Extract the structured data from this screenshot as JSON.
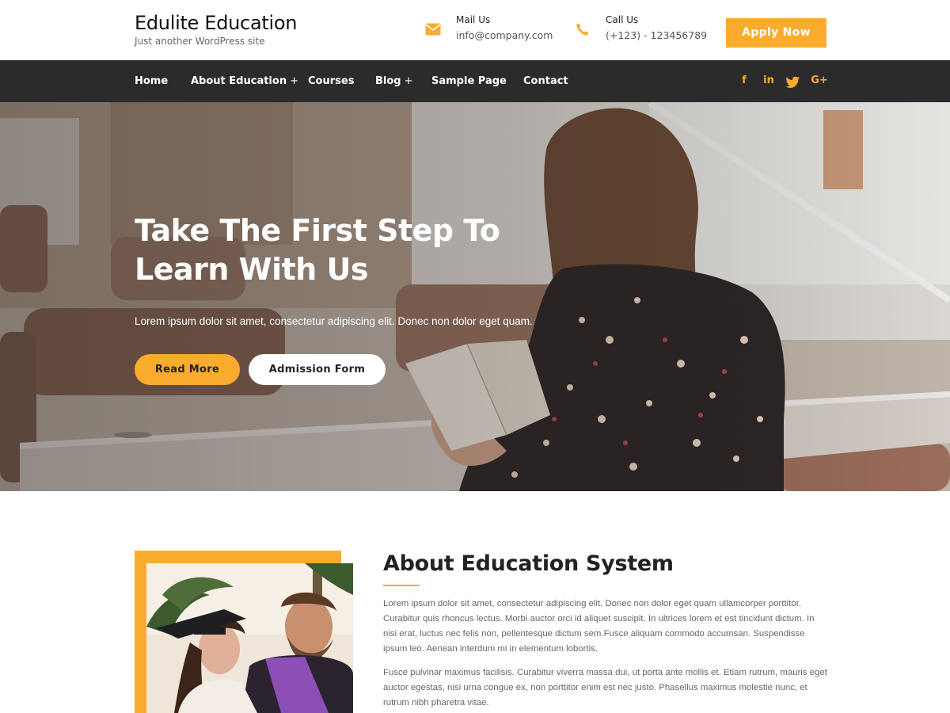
{
  "header": {
    "site_title": "Edulite Education",
    "tagline": "Just another WordPress site",
    "mail": {
      "label": "Mail Us",
      "value": "info@company.com",
      "icon": "envelope-icon"
    },
    "call": {
      "label": "Call Us",
      "value": "(+123) - 123456789",
      "icon": "phone-icon"
    },
    "apply_label": "Apply Now"
  },
  "nav": {
    "items": [
      {
        "label": "Home",
        "has_submenu": false
      },
      {
        "label": "About Education",
        "has_submenu": true
      },
      {
        "label": "Courses",
        "has_submenu": false
      },
      {
        "label": "Blog",
        "has_submenu": true
      },
      {
        "label": "Sample Page",
        "has_submenu": false
      },
      {
        "label": "Contact",
        "has_submenu": false
      }
    ],
    "submenu_indicator": "+",
    "social": [
      {
        "name": "facebook-icon",
        "glyph": "f"
      },
      {
        "name": "linkedin-icon",
        "glyph": "in"
      },
      {
        "name": "twitter-icon",
        "glyph": "twitter"
      },
      {
        "name": "google-plus-icon",
        "glyph": "G+"
      }
    ]
  },
  "hero": {
    "title": "Take The First Step To Learn With Us",
    "text": "Lorem ipsum dolor sit amet, consectetur adipiscing elit. Donec non dolor eget quam.",
    "primary_button": "Read More",
    "secondary_button": "Admission Form"
  },
  "about": {
    "title": "About Education System",
    "paragraph1": "Lorem ipsum dolor sit amet, consectetur adipiscing elit. Donec non dolor eget quam ullamcorper porttitor. Curabitur quis rhoncus lectus. Morbi auctor orci id aliquet suscipit. In ultrices lorem et est tincidunt dictum. In nisi erat, luctus nec felis non, pellentesque dictum sem.Fusce aliquam commodo accumsan. Suspendisse ipsum leo. Aenean interdum mi in elementum lobortis.",
    "paragraph2": "Fusce pulvinar maximus facilisis. Curabitur viverra massa dui, ut porta ante mollis et. Etiam rutrum, mauris eget auctor egestas, nisi urna congue ex, non porttitor enim est nec justo. Phasellus maximus molestie nunc, et rutrum nibh pharetra vitae."
  },
  "colors": {
    "accent": "#fbab2e",
    "nav_background": "#2b2b2b",
    "heading": "#222222",
    "body_text": "#666666"
  }
}
